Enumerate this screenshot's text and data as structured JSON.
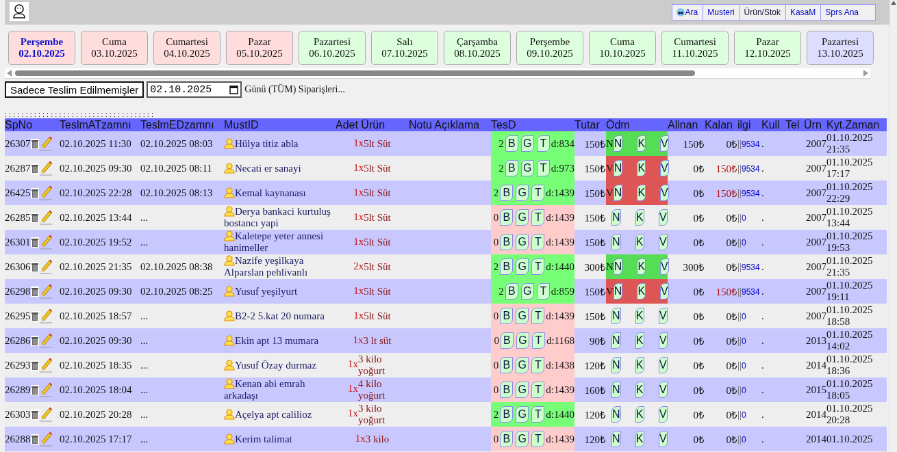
{
  "nav": [
    {
      "label": "Ara",
      "kind": "search",
      "color": "#0000cc"
    },
    {
      "label": "Musteri",
      "kind": "link",
      "color": "#0000cc"
    },
    {
      "label": "Ürün/Stok",
      "kind": "link",
      "color": "#111133"
    },
    {
      "label": "KasaM",
      "kind": "link",
      "color": "#0000cc"
    },
    {
      "label": "Sprs Ana",
      "kind": "link",
      "color": "#0000cc"
    }
  ],
  "days": [
    {
      "day": "Perşembe",
      "date": "02.10.2025",
      "selected": true,
      "color": "#ffdddd"
    },
    {
      "day": "Cuma",
      "date": "03.10.2025",
      "selected": false,
      "color": "#ffdddd"
    },
    {
      "day": "Cumartesi",
      "date": "04.10.2025",
      "selected": false,
      "color": "#ffdddd"
    },
    {
      "day": "Pazar",
      "date": "05.10.2025",
      "selected": false,
      "color": "#ffdddd"
    },
    {
      "day": "Pazartesi",
      "date": "06.10.2025",
      "selected": false,
      "color": "#ddffdd"
    },
    {
      "day": "Salı",
      "date": "07.10.2025",
      "selected": false,
      "color": "#ddffdd"
    },
    {
      "day": "Çarşamba",
      "date": "08.10.2025",
      "selected": false,
      "color": "#ddffdd"
    },
    {
      "day": "Perşembe",
      "date": "09.10.2025",
      "selected": false,
      "color": "#ddffdd"
    },
    {
      "day": "Cuma",
      "date": "10.10.2025",
      "selected": false,
      "color": "#ddffdd"
    },
    {
      "day": "Cumartesi",
      "date": "11.10.2025",
      "selected": false,
      "color": "#ddffdd"
    },
    {
      "day": "Pazar",
      "date": "12.10.2025",
      "selected": false,
      "color": "#ddffdd"
    },
    {
      "day": "Pazartesi",
      "date": "13.10.2025",
      "selected": false,
      "color": "#ddddff"
    }
  ],
  "filter_button": "Sadece Teslim Edilmemişler",
  "date_field": {
    "value": "02.10.2025"
  },
  "filter_caption": "Günü (TÜM) Siparişleri...",
  "dots_line": ": : : : : : : : : : : : : : : : : : : : : : : : : : : : : : : : : : : :",
  "columns": [
    "SpNo",
    "TeslmATzamnı",
    "TeslmEDzamnı",
    "MustID",
    "Adet Ürün",
    "Notu Açıklama",
    "TesD",
    "Tutar",
    "Ödm",
    "Alinan",
    "Kalan",
    "ilgi",
    "Kull",
    "Tel",
    "Ürn",
    "Kyt.Zaman"
  ],
  "rows": [
    {
      "spno": "26307",
      "at": "02.10.2025 11:30",
      "ed": "02.10.2025 08:03",
      "customer": "Hülya titiz abla",
      "qty": "1x",
      "product": "5lt Süt",
      "delivered": true,
      "count": "2",
      "tes_keys": [
        "B",
        "G",
        "T"
      ],
      "dist": "d:834",
      "amount": "150₺",
      "payment": {
        "kind": "paid",
        "code": "N"
      },
      "pay_keys": [
        "N",
        "K",
        "V"
      ],
      "received": "150₺",
      "remaining": "0₺",
      "due": false,
      "sep": "||",
      "ref": "9534",
      "ref_end": ".",
      "user": "2007",
      "rec_date": "01.10.2025",
      "rec_time": "21:35"
    },
    {
      "spno": "26287",
      "at": "02.10.2025 09:30",
      "ed": "02.10.2025 08:11",
      "customer": "Necati er sanayi",
      "qty": "1x",
      "product": "5lt Süt",
      "delivered": true,
      "count": "2",
      "tes_keys": [
        "B",
        "G",
        "T"
      ],
      "dist": "d:973",
      "amount": "150₺",
      "payment": {
        "kind": "credit",
        "code": "V"
      },
      "pay_keys": [
        "N",
        "K",
        "V"
      ],
      "received": "0₺",
      "remaining": "150₺",
      "due": true,
      "sep": "||",
      "ref": "9534",
      "ref_end": ".",
      "user": "2007",
      "rec_date": "01.10.2025",
      "rec_time": "17:17"
    },
    {
      "spno": "26425",
      "at": "02.10.2025 22:28",
      "ed": "02.10.2025 08:13",
      "customer": "Kemal kaynanası",
      "qty": "1x",
      "product": "5lt Süt",
      "delivered": true,
      "count": "2",
      "tes_keys": [
        "B",
        "G",
        "T"
      ],
      "dist": "d:1439",
      "amount": "150₺",
      "payment": {
        "kind": "credit",
        "code": "V"
      },
      "pay_keys": [
        "N",
        "K",
        "V"
      ],
      "received": "0₺",
      "remaining": "150₺",
      "due": true,
      "sep": "||",
      "ref": "9534",
      "ref_end": ".",
      "user": "2007",
      "rec_date": "01.10.2025",
      "rec_time": "22:29"
    },
    {
      "spno": "26285",
      "at": "02.10.2025 13:44",
      "ed": "...",
      "customer": "Derya bankaci kurtuluş bostancı yapi",
      "qty": "1x",
      "product": "5lt Süt",
      "delivered": false,
      "count": "0",
      "tes_keys": [
        "B",
        "G",
        "T"
      ],
      "dist": "d:1439",
      "amount": "150₺",
      "payment": {
        "kind": "none"
      },
      "pay_keys": [
        "N",
        "K",
        "V"
      ],
      "received": "0₺",
      "remaining": "0₺",
      "due": false,
      "sep": "||",
      "ref": "0",
      "ref_end": ".",
      "user": "2007",
      "rec_date": "01.10.2025",
      "rec_time": "13:44"
    },
    {
      "spno": "26301",
      "at": "02.10.2025 19:52",
      "ed": "...",
      "customer": "Kaletepe yeter annesi hanimeller",
      "qty": "1x",
      "product": "5lt Süt",
      "delivered": false,
      "count": "0",
      "tes_keys": [
        "B",
        "G",
        "T"
      ],
      "dist": "d:1439",
      "amount": "150₺",
      "payment": {
        "kind": "none"
      },
      "pay_keys": [
        "N",
        "K",
        "V"
      ],
      "received": "0₺",
      "remaining": "0₺",
      "due": false,
      "sep": "||",
      "ref": "0",
      "ref_end": ".",
      "user": "2007",
      "rec_date": "01.10.2025",
      "rec_time": "19:53"
    },
    {
      "spno": "26306",
      "at": "02.10.2025 21:35",
      "ed": "02.10.2025 08:38",
      "customer": "Nazife yeşilkaya Alparslan pehlivanlı",
      "qty": "2x",
      "product": "5lt Süt",
      "delivered": true,
      "count": "2",
      "tes_keys": [
        "B",
        "G",
        "T"
      ],
      "dist": "d:1440",
      "amount": "300₺",
      "payment": {
        "kind": "paid",
        "code": "N"
      },
      "pay_keys": [
        "N",
        "K",
        "V"
      ],
      "received": "300₺",
      "remaining": "0₺",
      "due": false,
      "sep": "||",
      "ref": "9534",
      "ref_end": ".",
      "user": "2007",
      "rec_date": "01.10.2025",
      "rec_time": "21:35"
    },
    {
      "spno": "26298",
      "at": "02.10.2025 09:30",
      "ed": "02.10.2025 08:25",
      "customer": "Yusuf yeşilyurt",
      "qty": "1x",
      "product": "5lt Süt",
      "delivered": true,
      "count": "2",
      "tes_keys": [
        "B",
        "G",
        "T"
      ],
      "dist": "d:859",
      "amount": "150₺",
      "payment": {
        "kind": "credit",
        "code": "V"
      },
      "pay_keys": [
        "N",
        "K",
        "V"
      ],
      "received": "0₺",
      "remaining": "150₺",
      "due": true,
      "sep": "||",
      "ref": "9534",
      "ref_end": ".",
      "user": "2007",
      "rec_date": "01.10.2025",
      "rec_time": "19:11"
    },
    {
      "spno": "26295",
      "at": "02.10.2025 18:57",
      "ed": "...",
      "customer": "B2-2 5.kat 20 numara",
      "qty": "1x",
      "product": "5lt Süt",
      "delivered": false,
      "count": "0",
      "tes_keys": [
        "B",
        "G",
        "T"
      ],
      "dist": "d:1439",
      "amount": "150₺",
      "payment": {
        "kind": "none"
      },
      "pay_keys": [
        "N",
        "K",
        "V"
      ],
      "received": "0₺",
      "remaining": "0₺",
      "due": false,
      "sep": "||",
      "ref": "0",
      "ref_end": ".",
      "user": "2007",
      "rec_date": "01.10.2025",
      "rec_time": "18:58"
    },
    {
      "spno": "26286",
      "at": "02.10.2025 09:30",
      "ed": "...",
      "customer": "Ekin apt 13 mumara",
      "qty": "1x",
      "product": "3 lt süt",
      "delivered": false,
      "count": "0",
      "tes_keys": [
        "B",
        "G",
        "T"
      ],
      "dist": "d:1168",
      "amount": "90₺",
      "payment": {
        "kind": "none"
      },
      "pay_keys": [
        "N",
        "K",
        "V"
      ],
      "received": "0₺",
      "remaining": "0₺",
      "due": false,
      "sep": "||",
      "ref": "0",
      "ref_end": ".",
      "user": "2013",
      "rec_date": "01.10.2025",
      "rec_time": "14:02"
    },
    {
      "spno": "26293",
      "at": "02.10.2025 18:35",
      "ed": "...",
      "customer": "Yusuf Özay durmaz",
      "qty": "1x",
      "product": "3 kilo yoğurt",
      "delivered": false,
      "count": "0",
      "tes_keys": [
        "B",
        "G",
        "T"
      ],
      "dist": "d:1438",
      "amount": "120₺",
      "payment": {
        "kind": "none"
      },
      "pay_keys": [
        "N",
        "K",
        "V"
      ],
      "received": "0₺",
      "remaining": "0₺",
      "due": false,
      "sep": "||",
      "ref": "0",
      "ref_end": ".",
      "user": "2014",
      "rec_date": "01.10.2025",
      "rec_time": "18:36"
    },
    {
      "spno": "26289",
      "at": "02.10.2025 18:04",
      "ed": "...",
      "customer": "Kenan abi emrah arkadaşı",
      "qty": "1x",
      "product": "4 kilo yoğurt",
      "delivered": false,
      "count": "0",
      "tes_keys": [
        "B",
        "G",
        "T"
      ],
      "dist": "d:1439",
      "amount": "160₺",
      "payment": {
        "kind": "none"
      },
      "pay_keys": [
        "N",
        "K",
        "V"
      ],
      "received": "0₺",
      "remaining": "0₺",
      "due": false,
      "sep": "||",
      "ref": "0",
      "ref_end": ".",
      "user": "2015",
      "rec_date": "01.10.2025",
      "rec_time": "18:05"
    },
    {
      "spno": "26303",
      "at": "02.10.2025 20:28",
      "ed": "...",
      "customer": "Açelya apt calilioz",
      "qty": "1x",
      "product": "3 kilo yoğurt",
      "delivered": true,
      "count": "2",
      "tes_keys": [
        "B",
        "G",
        "T"
      ],
      "dist": "d:1440",
      "amount": "120₺",
      "payment": {
        "kind": "none"
      },
      "pay_keys": [
        "N",
        "K",
        "V"
      ],
      "received": "0₺",
      "remaining": "0₺",
      "due": false,
      "sep": "||",
      "ref": "0",
      "ref_end": ".",
      "user": "2014",
      "rec_date": "01.10.2025",
      "rec_time": "20:28"
    },
    {
      "spno": "26288",
      "at": "02.10.2025 17:17",
      "ed": "...",
      "customer": "Kerim talimat",
      "qty": "1x",
      "product": "3 kilo",
      "delivered": false,
      "count": "0",
      "tes_keys": [
        "B",
        "G",
        "T"
      ],
      "dist": "d:1439",
      "amount": "120₺",
      "payment": {
        "kind": "none"
      },
      "pay_keys": [
        "N",
        "K",
        "V"
      ],
      "received": "0₺",
      "remaining": "0₺",
      "due": false,
      "sep": "||",
      "ref": "0",
      "ref_end": ".",
      "user": "2014",
      "rec_date": "01.10.2025"
    }
  ]
}
